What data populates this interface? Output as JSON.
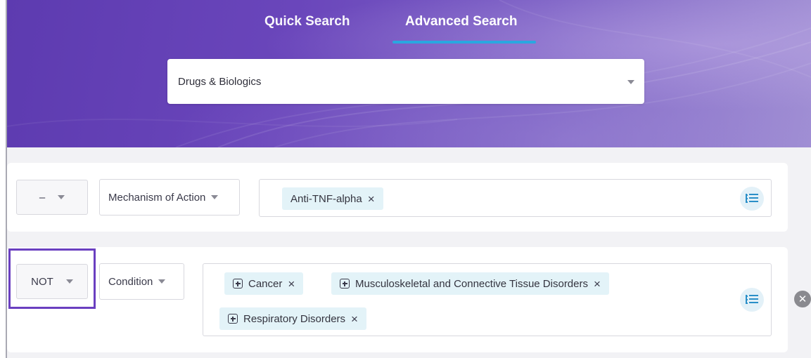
{
  "tabs": {
    "quick": "Quick Search",
    "advanced": "Advanced Search",
    "active": "Advanced Search"
  },
  "database_select": {
    "value": "Drugs & Biologics"
  },
  "rows": [
    {
      "operator": "–",
      "field": "Mechanism of Action",
      "chips": [
        {
          "label": "Anti-TNF-alpha",
          "expandable": false
        }
      ]
    },
    {
      "operator": "NOT",
      "field": "Condition",
      "chips": [
        {
          "label": "Cancer",
          "expandable": true
        },
        {
          "label": "Musculoskeletal and Connective Tissue Disorders",
          "expandable": true
        },
        {
          "label": "Respiratory Disorders",
          "expandable": true
        }
      ]
    }
  ],
  "icons": {
    "chip_remove": "×",
    "row_remove": "✕",
    "list_icon": "list-tree-icon"
  },
  "colors": {
    "accent_underline": "#2aa7e0",
    "highlight_border": "#6a3fc0",
    "chip_background": "#e3f3f8",
    "list_icon_color": "#2a8fc8"
  }
}
